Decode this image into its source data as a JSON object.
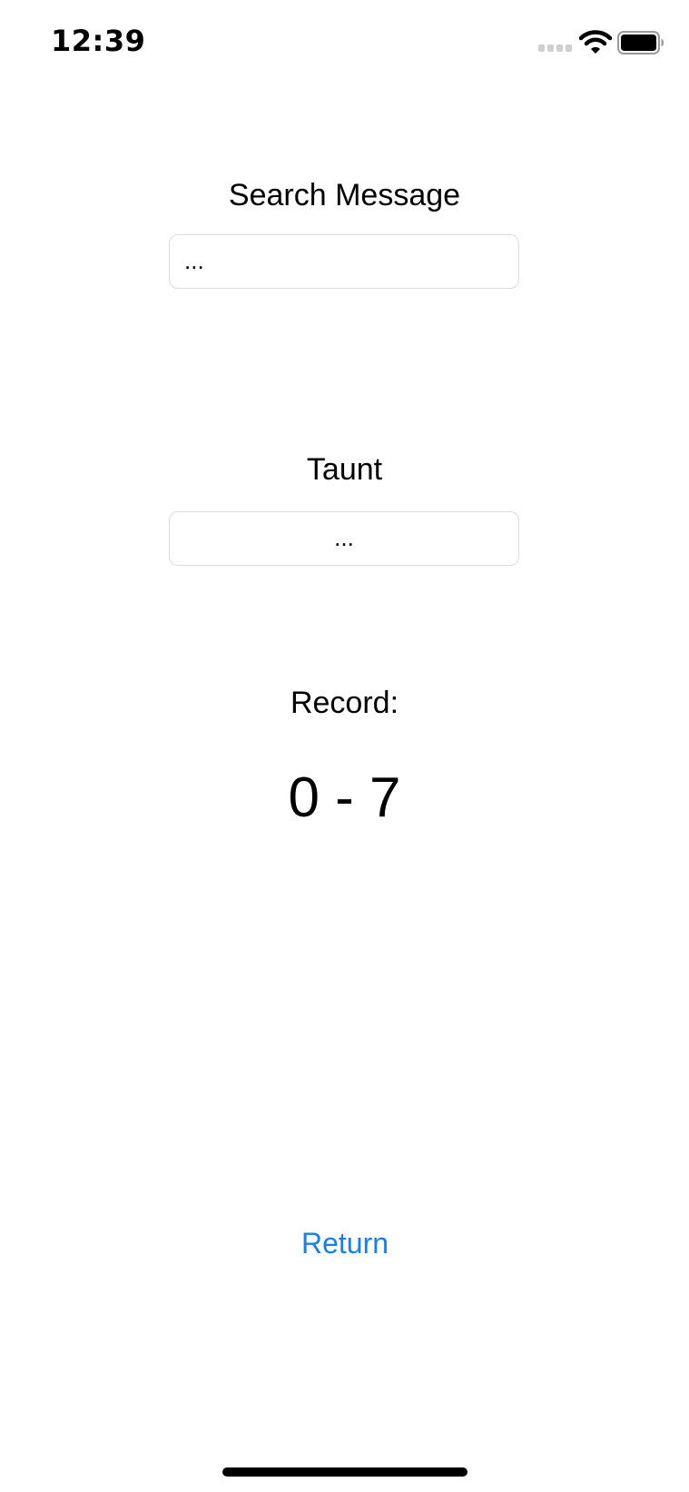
{
  "status_bar": {
    "time": "12:39",
    "signal_icon": "cellular-signal-icon",
    "wifi_icon": "wifi-icon",
    "battery_icon": "battery-icon"
  },
  "search": {
    "label": "Search Message",
    "value": "..."
  },
  "taunt": {
    "label": "Taunt",
    "value": "..."
  },
  "record": {
    "label": "Record:",
    "value": "0 - 7"
  },
  "actions": {
    "return_label": "Return"
  },
  "colors": {
    "accent": "#1a7fe9",
    "text": "#000000",
    "field_border": "#dcdcdc",
    "background": "#ffffff"
  }
}
